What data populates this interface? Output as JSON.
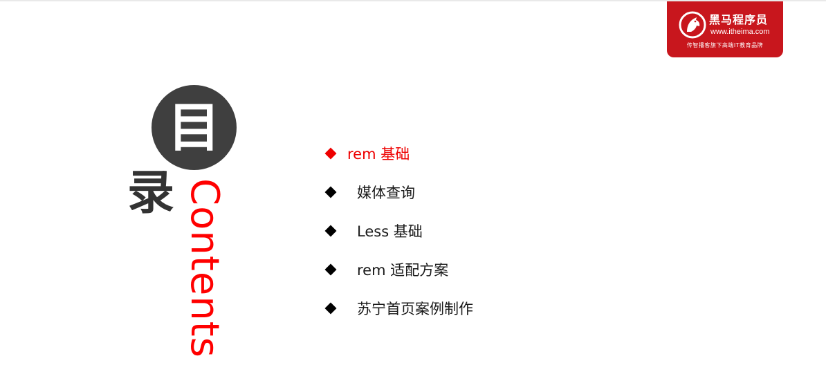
{
  "brand": {
    "name": "黑马程序员",
    "url": "www.itheima.com",
    "tagline": "传智播客旗下高端IT教育品牌",
    "color": "#c8161d",
    "icon": "horse-head-icon"
  },
  "title": {
    "char1": "目",
    "char2": "录",
    "english": "Contents",
    "accent_color": "#ff0000",
    "circle_color": "#3f3f3f"
  },
  "menu": {
    "active_index": 0,
    "items": [
      {
        "label": "rem 基础"
      },
      {
        "label": "媒体查询"
      },
      {
        "label": "Less 基础"
      },
      {
        "label": "rem 适配方案"
      },
      {
        "label": "苏宁首页案例制作"
      }
    ]
  }
}
